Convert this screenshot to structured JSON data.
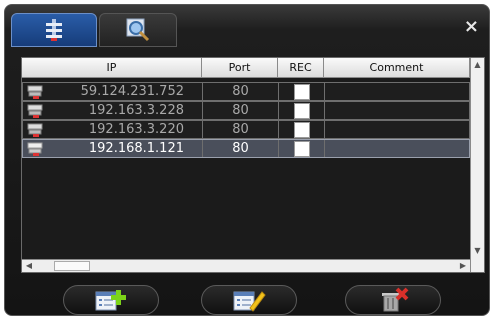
{
  "window": {
    "close_label": "×"
  },
  "tabs": [
    {
      "icon": "device-list-icon",
      "active": true
    },
    {
      "icon": "search-icon",
      "active": false
    }
  ],
  "table": {
    "columns": [
      "IP",
      "Port",
      "REC",
      "Comment"
    ],
    "rows": [
      {
        "ip": "59.124.231.752",
        "port": "80",
        "rec": false,
        "comment": "",
        "selected": false
      },
      {
        "ip": "192.163.3.228",
        "port": "80",
        "rec": false,
        "comment": "",
        "selected": false
      },
      {
        "ip": "192.163.3.220",
        "port": "80",
        "rec": false,
        "comment": "",
        "selected": false
      },
      {
        "ip": "192.168.1.121",
        "port": "80",
        "rec": false,
        "comment": "",
        "selected": true
      }
    ]
  },
  "buttons": [
    {
      "icon": "add-device-icon"
    },
    {
      "icon": "edit-device-icon"
    },
    {
      "icon": "delete-device-icon"
    }
  ],
  "colors": {
    "accent": "#2a5da8",
    "add": "#7cd319",
    "edit": "#f2c21a",
    "delete": "#d9302a"
  }
}
